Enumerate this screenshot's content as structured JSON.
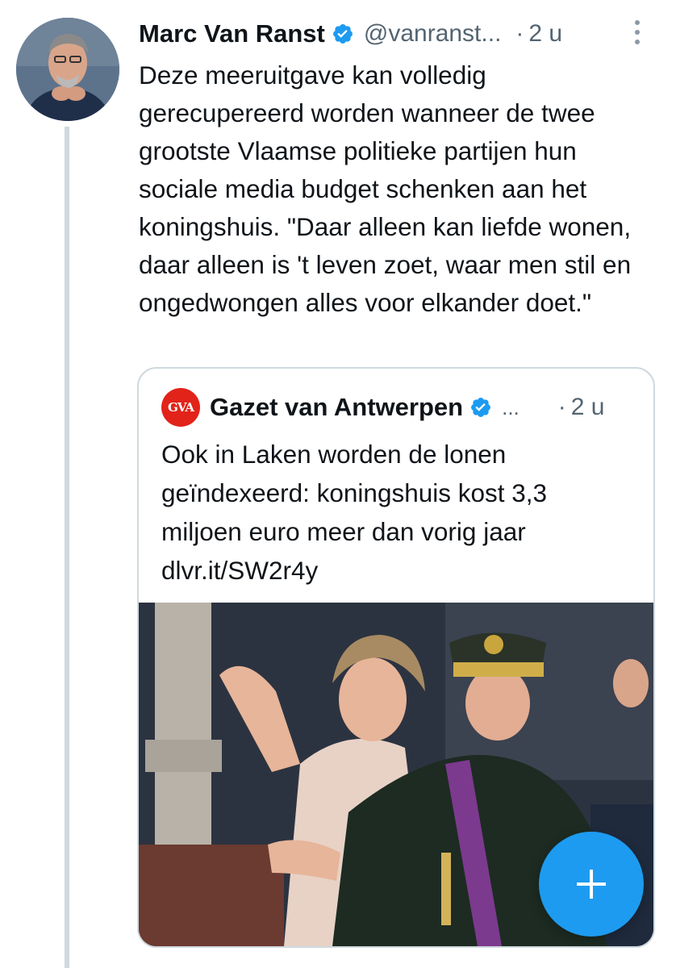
{
  "tweet": {
    "author_name": "Marc Van Ranst",
    "handle": "@vanranst...",
    "separator": "·",
    "time": "2 u",
    "text": "Deze meeruitgave kan volledig gerecupereerd worden wanneer de twee grootste Vlaamse politieke partijen hun sociale media budget schenken aan het koningshuis. \"Daar alleen kan liefde wonen, daar alleen is 't leven zoet, waar men stil en ongedwongen alles voor elkander doet.\""
  },
  "quoted_tweet": {
    "logo_text": "GVA",
    "author_name": "Gazet van Antwerpen",
    "handle": "...",
    "separator": "·",
    "time": "2 u",
    "text_lines": [
      "Ook in Laken worden de lonen",
      "geïndexeerd: koningshuis kost 3,3",
      "miljoen euro meer dan vorig jaar",
      "dlvr.it/SW2r4y"
    ]
  },
  "colors": {
    "accent": "#1d9bf0",
    "text": "#0f1419",
    "secondary": "#536471",
    "gva_red": "#e2231a"
  },
  "icons": {
    "verified": "verified-badge-icon",
    "more": "more-vertical-icon",
    "compose": "plus-icon"
  }
}
